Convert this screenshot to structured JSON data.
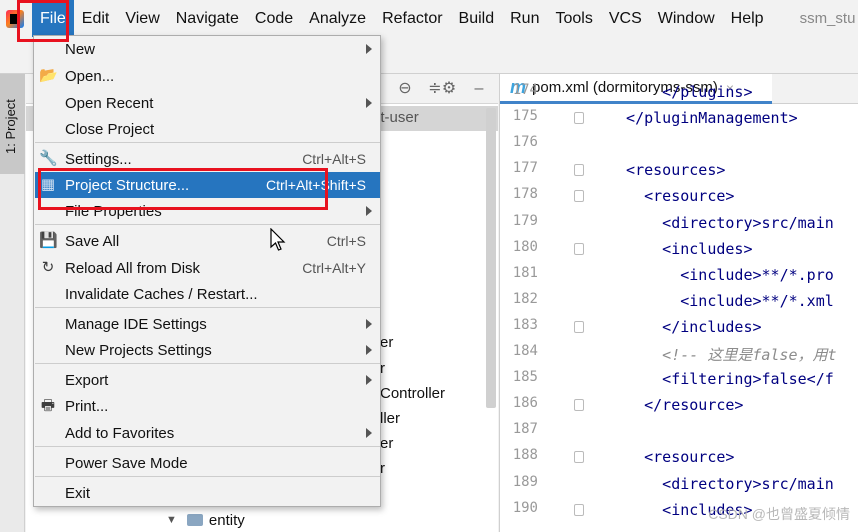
{
  "menubar": {
    "items": [
      "File",
      "Edit",
      "View",
      "Navigate",
      "Code",
      "Analyze",
      "Refactor",
      "Build",
      "Run",
      "Tools",
      "VCS",
      "Window",
      "Help"
    ],
    "active_index": 0,
    "project_name": "ssm_stu"
  },
  "tool_window": {
    "label": "1: Project"
  },
  "project_panel": {
    "module_fragment": "nt-user",
    "tree_fragments": [
      "er",
      "r",
      "Controller",
      "ller",
      "er",
      "r"
    ],
    "entity_label": "entity"
  },
  "editor": {
    "tab_label": "pom.xml (dormitoryms-ssm)",
    "maven_icon": "m",
    "lines": [
      {
        "no": "174",
        "text": "      </plugins>"
      },
      {
        "no": "175",
        "text": "  </pluginManagement>"
      },
      {
        "no": "176",
        "text": ""
      },
      {
        "no": "177",
        "text": "  <resources>"
      },
      {
        "no": "178",
        "text": "    <resource>"
      },
      {
        "no": "179",
        "text": "      <directory>src/main"
      },
      {
        "no": "180",
        "text": "      <includes>"
      },
      {
        "no": "181",
        "text": "        <include>**/*.pro"
      },
      {
        "no": "182",
        "text": "        <include>**/*.xml"
      },
      {
        "no": "183",
        "text": "      </includes>"
      },
      {
        "no": "184",
        "text": "      <!-- 这里是false，用t"
      },
      {
        "no": "185",
        "text": "      <filtering>false</f"
      },
      {
        "no": "186",
        "text": "    </resource>"
      },
      {
        "no": "187",
        "text": ""
      },
      {
        "no": "188",
        "text": "    <resource>"
      },
      {
        "no": "189",
        "text": "      <directory>src/main"
      },
      {
        "no": "190",
        "text": "      <includes>"
      }
    ]
  },
  "file_menu": {
    "items": [
      {
        "label": "New",
        "shortcut": "",
        "submenu": true,
        "icon": ""
      },
      {
        "label": "Open...",
        "shortcut": "",
        "submenu": false,
        "icon": "folder-open-icon"
      },
      {
        "label": "Open Recent",
        "shortcut": "",
        "submenu": true,
        "icon": ""
      },
      {
        "label": "Close Project",
        "shortcut": "",
        "submenu": false,
        "icon": ""
      },
      {
        "label": "Settings...",
        "shortcut": "Ctrl+Alt+S",
        "submenu": false,
        "icon": "wrench-icon"
      },
      {
        "label": "Project Structure...",
        "shortcut": "Ctrl+Alt+Shift+S",
        "submenu": false,
        "icon": "project-structure-icon",
        "highlighted": true
      },
      {
        "label": "File Properties",
        "shortcut": "",
        "submenu": true,
        "icon": ""
      },
      {
        "label": "Save All",
        "shortcut": "Ctrl+S",
        "submenu": false,
        "icon": "save-icon"
      },
      {
        "label": "Reload All from Disk",
        "shortcut": "Ctrl+Alt+Y",
        "submenu": false,
        "icon": "reload-icon"
      },
      {
        "label": "Invalidate Caches / Restart...",
        "shortcut": "",
        "submenu": false,
        "icon": ""
      },
      {
        "label": "Manage IDE Settings",
        "shortcut": "",
        "submenu": true,
        "icon": ""
      },
      {
        "label": "New Projects Settings",
        "shortcut": "",
        "submenu": true,
        "icon": ""
      },
      {
        "label": "Export",
        "shortcut": "",
        "submenu": true,
        "icon": ""
      },
      {
        "label": "Print...",
        "shortcut": "",
        "submenu": false,
        "icon": "print-icon"
      },
      {
        "label": "Add to Favorites",
        "shortcut": "",
        "submenu": true,
        "icon": ""
      },
      {
        "label": "Power Save Mode",
        "shortcut": "",
        "submenu": false,
        "icon": ""
      },
      {
        "label": "Exit",
        "shortcut": "",
        "submenu": false,
        "icon": ""
      }
    ]
  },
  "colors": {
    "menu_highlight": "#2675bf",
    "annotation_red": "#e8121f",
    "xml_tag": "#000080"
  },
  "watermark": "CSDN @也曾盛夏倾情"
}
